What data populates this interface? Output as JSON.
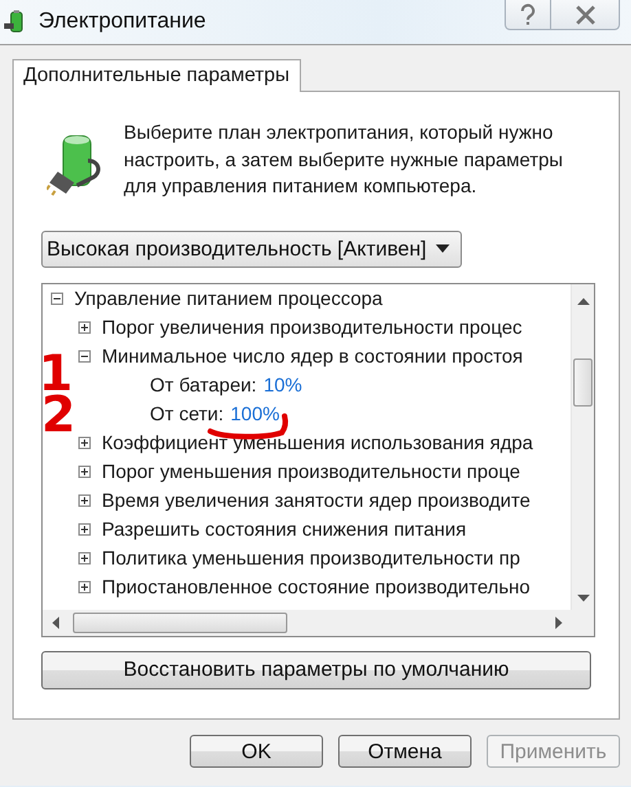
{
  "window": {
    "title": "Электропитание"
  },
  "tabs": [
    {
      "label": "Дополнительные параметры",
      "selected": true
    }
  ],
  "description": "Выберите план электропитания, который нужно настроить, а затем выберите нужные параметры для управления питанием компьютера.",
  "plan_dropdown": {
    "value": "Высокая производительность [Активен]"
  },
  "settings_tree": [
    {
      "label": "Управление питанием процессора",
      "expanded": true,
      "children": [
        {
          "label": "Порог увеличения производительности процес",
          "expanded": false
        },
        {
          "label": "Минимальное число ядер в состоянии простоя",
          "expanded": true,
          "children": [
            {
              "label": "От батареи:",
              "value": "10%"
            },
            {
              "label": "От сети:",
              "value": "100%"
            }
          ]
        },
        {
          "label": "Коэффициент уменьшения использования ядра",
          "expanded": false
        },
        {
          "label": "Порог уменьшения производительности проце",
          "expanded": false
        },
        {
          "label": "Время увеличения занятости ядер производите",
          "expanded": false
        },
        {
          "label": "Разрешить состояния снижения питания",
          "expanded": false
        },
        {
          "label": "Политика уменьшения производительности пр",
          "expanded": false
        },
        {
          "label": "Приостановленное состояние производительно",
          "expanded": false
        }
      ]
    }
  ],
  "restore_button": "Восстановить параметры по умолчанию",
  "buttons": [
    {
      "label": "OK",
      "disabled": false
    },
    {
      "label": "Отмена",
      "disabled": false
    },
    {
      "label": "Применить",
      "disabled": true
    }
  ],
  "annotations": [
    {
      "kind": "digit",
      "text": "1"
    },
    {
      "kind": "digit",
      "text": "2"
    },
    {
      "kind": "underline"
    }
  ]
}
